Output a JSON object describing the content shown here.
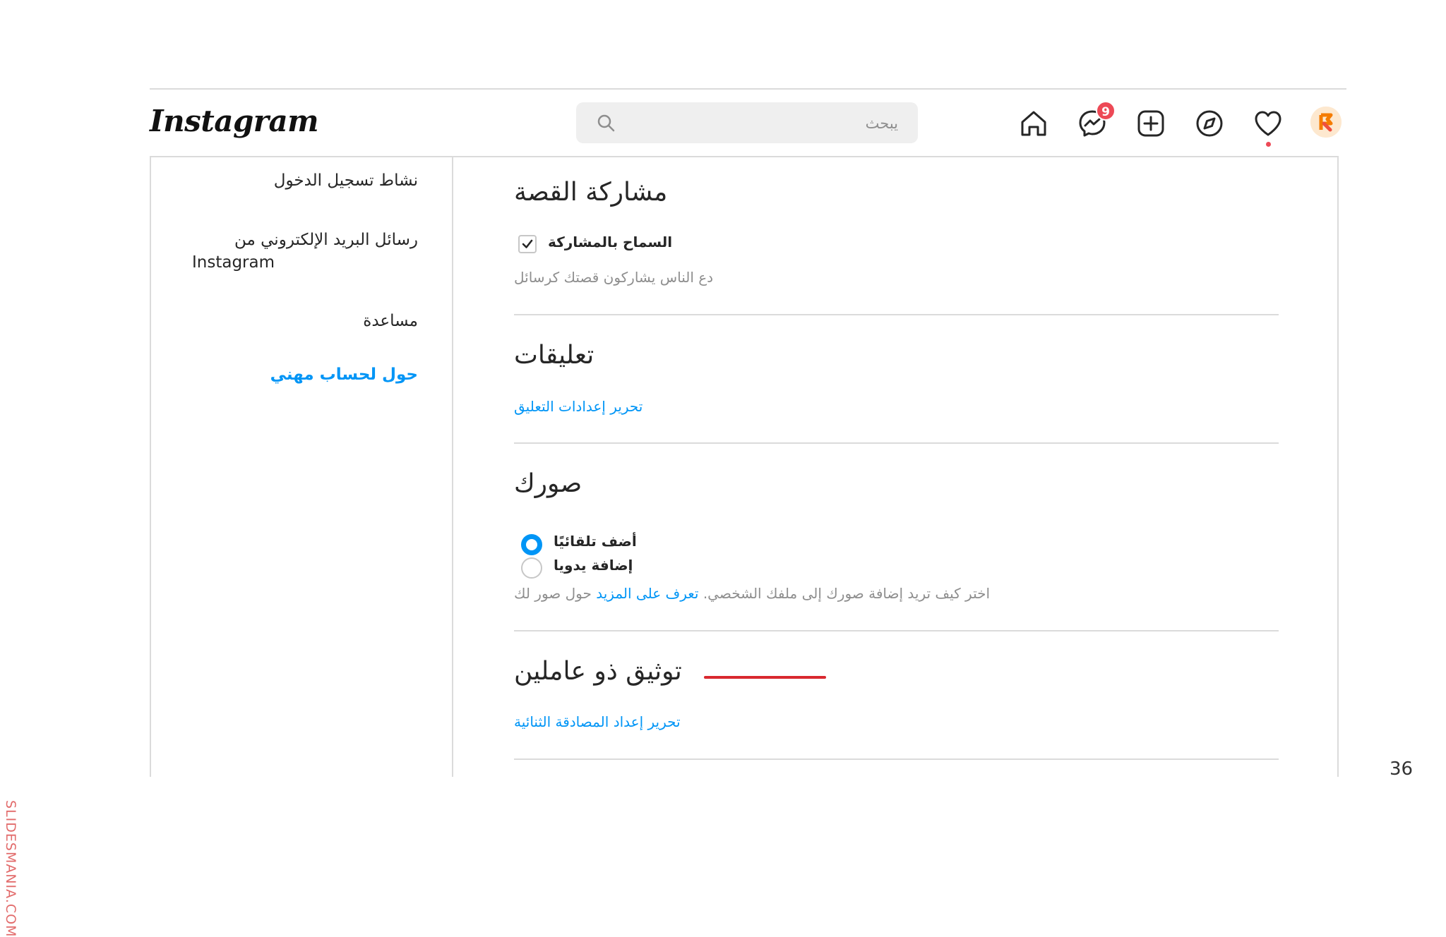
{
  "header": {
    "logo_text": "Instagram",
    "search": {
      "placeholder": "يبحث",
      "icon": "search-icon"
    },
    "nav": {
      "icons": [
        "home-icon",
        "messenger-icon",
        "new-post-icon",
        "explore-icon",
        "activity-heart-icon",
        "profile-avatar"
      ],
      "messages_badge": "9"
    }
  },
  "sidebar": {
    "items": [
      {
        "label": "نشاط تسجيل الدخول"
      },
      {
        "label": "رسائل البريد الإلكتروني من",
        "label_line2": "Instagram"
      },
      {
        "label": "مساعدة"
      },
      {
        "label": "حول لحساب مهني"
      }
    ]
  },
  "main": {
    "story": {
      "title": "مشاركة القصة",
      "checkbox_label": "السماح بالمشاركة",
      "checked": true,
      "description": "دع الناس يشاركون قصتك كرسائل"
    },
    "comments": {
      "title": "تعليقات",
      "link": "تحرير إعدادات التعليق"
    },
    "photos": {
      "title": "صورك",
      "options": [
        {
          "label": "أضف تلقائيًا",
          "selected": true
        },
        {
          "label": "إضافة يدويا",
          "selected": false
        }
      ],
      "description_before": "اختر كيف تريد إضافة صورك إلى ملفك الشخصي.",
      "description_link": "تعرف على المزيد",
      "description_after": "حول صور لك"
    },
    "two_factor": {
      "title": "توثيق ذو عاملين",
      "link": "تحرير إعداد المصادقة الثنائية"
    }
  },
  "slide": {
    "watermark": "SLIDESMANIA.COM",
    "page_number": "36"
  },
  "colors": {
    "link_blue": "#0095f6",
    "badge_red": "#ed4956",
    "annotation_red": "#d9282f",
    "border_gray": "#dbdbdb",
    "muted_text": "#8e8e8e"
  }
}
